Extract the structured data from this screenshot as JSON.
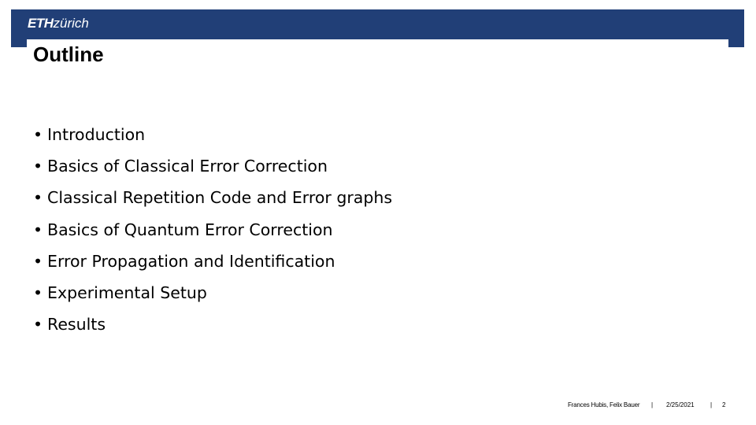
{
  "header": {
    "logo_bold": "ETH",
    "logo_light": "zürich",
    "brand_color": "#213f77"
  },
  "slide": {
    "title": "Outline",
    "bullet_glyph": "•",
    "items": [
      "Introduction",
      "Basics of Classical Error Correction",
      "Classical Repetition Code and Error graphs",
      "Basics of Quantum Error Correction",
      "Error Propagation and Identification",
      "Experimental Setup",
      "Results"
    ]
  },
  "footer": {
    "authors": "Frances Hubis, Felix Bauer",
    "separator": "|",
    "date": "2/25/2021",
    "page": "2"
  }
}
